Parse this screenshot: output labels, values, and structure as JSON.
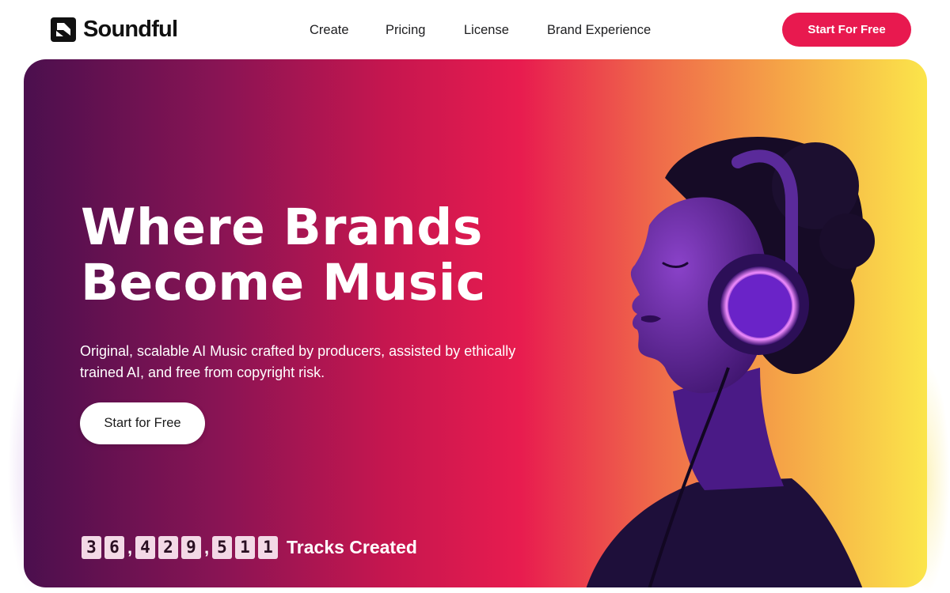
{
  "brand": {
    "name": "Soundful"
  },
  "nav": {
    "links": [
      "Create",
      "Pricing",
      "License",
      "Brand Experience"
    ],
    "cta_label": "Start For Free"
  },
  "hero": {
    "headline_line1": "Where Brands",
    "headline_line2": "Become Music",
    "subtext": "Original, scalable AI Music crafted by producers, assisted by ethically trained AI, and free from copyright risk.",
    "cta_label": "Start for Free",
    "counter": {
      "digits": [
        "3",
        "6",
        ",",
        "4",
        "2",
        "9",
        ",",
        "5",
        "1",
        "1"
      ],
      "label": "Tracks Created"
    }
  },
  "colors": {
    "accent": "#e8194f",
    "gradient": [
      "#4b0f4e",
      "#8a1454",
      "#c5164f",
      "#e81c4f",
      "#ef6a4a",
      "#f5a447",
      "#fbe54a"
    ]
  }
}
